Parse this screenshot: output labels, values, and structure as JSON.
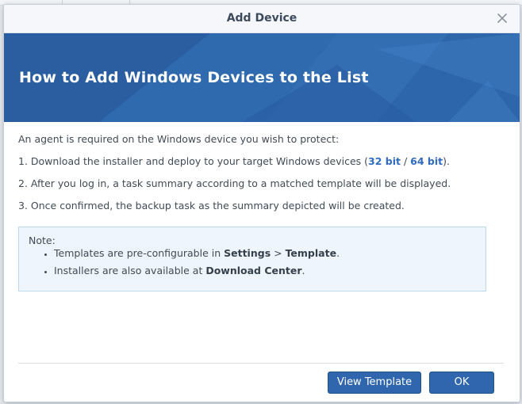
{
  "dialog": {
    "title": "Add Device",
    "close_icon": "close-icon"
  },
  "banner": {
    "title": "How to Add Windows Devices to the List",
    "color": "#2c62a7"
  },
  "instructions": {
    "intro": "An agent is required on the Windows device you wish to protect:",
    "step1_prefix": "1. Download the installer and deploy to your target Windows devices (",
    "link_32": "32 bit",
    "link_sep": " / ",
    "link_64": "64 bit",
    "step1_suffix": ").",
    "step2": "2. After you log in, a task summary according to a matched template will be displayed.",
    "step3": "3. Once confirmed, the backup task as the summary depicted will be created."
  },
  "note": {
    "label": "Note:",
    "item1_prefix": "Templates are pre-configurable in ",
    "item1_settings": "Settings",
    "item1_sep": " > ",
    "item1_template": "Template",
    "item1_suffix": ".",
    "item2_prefix": "Installers are also available at ",
    "item2_center": "Download Center",
    "item2_suffix": "."
  },
  "buttons": {
    "view_template": "View Template",
    "ok": "OK"
  },
  "colors": {
    "link": "#2f6bbf",
    "button": "#3066ad",
    "note_bg": "#eef5fd"
  }
}
